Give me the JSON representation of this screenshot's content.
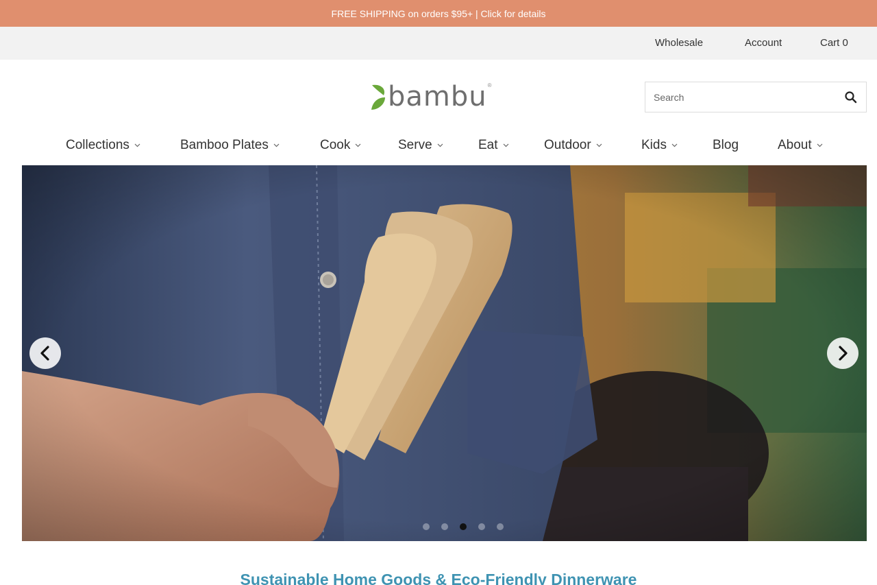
{
  "promo": {
    "text": "FREE SHIPPING on orders $95+ | Click for details"
  },
  "utility_nav": {
    "wholesale": "Wholesale",
    "account": "Account",
    "cart": "Cart 0"
  },
  "logo": {
    "text": "bambu",
    "registered_mark": "®",
    "accent_color": "#6aa83a"
  },
  "search": {
    "placeholder": "Search",
    "value": "",
    "icon": "search-icon"
  },
  "main_nav": {
    "items": [
      {
        "label": "Collections",
        "has_dropdown": true
      },
      {
        "label": "Bamboo Plates",
        "has_dropdown": true
      },
      {
        "label": "Cook",
        "has_dropdown": true
      },
      {
        "label": "Serve",
        "has_dropdown": true
      },
      {
        "label": "Eat",
        "has_dropdown": true
      },
      {
        "label": "Outdoor",
        "has_dropdown": true
      },
      {
        "label": "Kids",
        "has_dropdown": true
      },
      {
        "label": "Blog",
        "has_dropdown": false
      },
      {
        "label": "About",
        "has_dropdown": true
      }
    ]
  },
  "hero": {
    "prev_icon": "chevron-left-icon",
    "next_icon": "chevron-right-icon",
    "slide_count": 5,
    "active_slide": 3
  },
  "tagline": {
    "text": "Sustainable Home Goods & Eco-Friendly Dinnerware"
  },
  "colors": {
    "promo_bg": "#e08f6e",
    "utility_bg": "#f2f2f2",
    "tagline": "#3f93b2"
  }
}
